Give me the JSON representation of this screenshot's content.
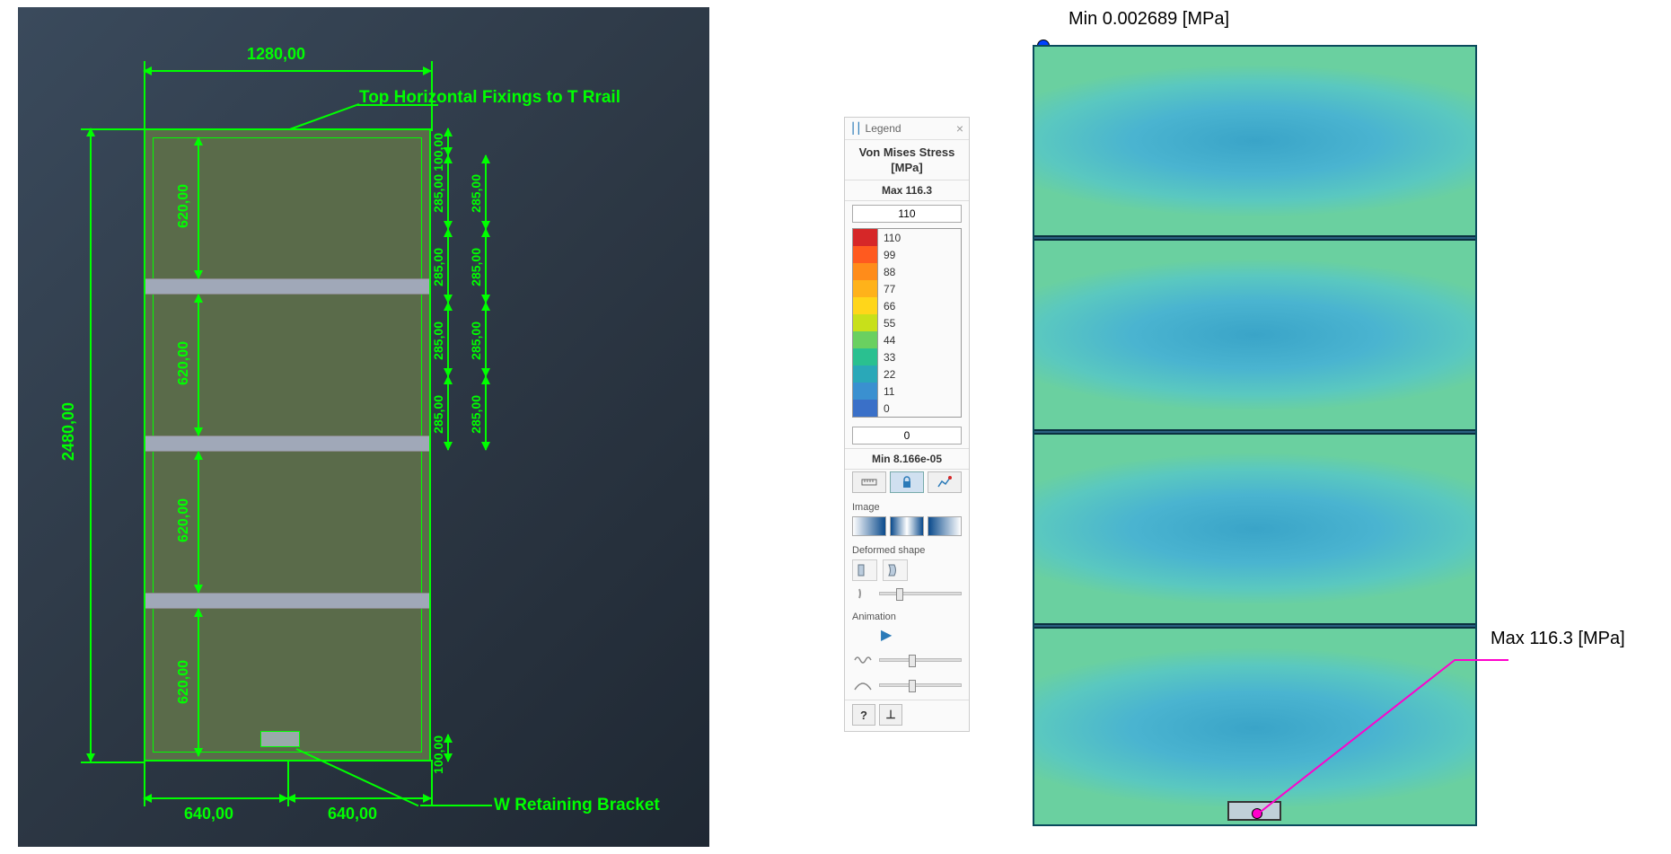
{
  "left": {
    "label_top": "Top Horizontal Fixings to T Rrail",
    "label_bottom": "W Retaining Bracket",
    "dim_width_top": "1280,00",
    "dim_height_left": "2480,00",
    "dim_width_bottom_left": "640,00",
    "dim_width_bottom_right": "640,00",
    "dim_100_top": "100,00",
    "dim_100_bot": "100,00",
    "dim_620": [
      "620,00",
      "620,00",
      "620,00",
      "620,00"
    ],
    "dim_285_outer": [
      "285,00",
      "285,00",
      "285,00",
      "285,00",
      "285,00",
      "285,00",
      "285,00",
      "285,00"
    ]
  },
  "right": {
    "min_label": "Min  0.002689  [MPa]",
    "max_label": "Max  116.3  [MPa]"
  },
  "legend": {
    "header": "Legend",
    "title": "Von Mises Stress",
    "unit": "[MPa]",
    "max_text": "Max  116.3",
    "min_text": "Min  8.166e-05",
    "input_top": "110",
    "input_bottom": "0",
    "scale": [
      {
        "v": "110",
        "c": "#d62728"
      },
      {
        "v": "99",
        "c": "#ff5a1f"
      },
      {
        "v": "88",
        "c": "#ff8c1a"
      },
      {
        "v": "77",
        "c": "#ffb21a"
      },
      {
        "v": "66",
        "c": "#ffd61a"
      },
      {
        "v": "55",
        "c": "#c8e01a"
      },
      {
        "v": "44",
        "c": "#6ad060"
      },
      {
        "v": "33",
        "c": "#2ac090"
      },
      {
        "v": "22",
        "c": "#2aa8b8"
      },
      {
        "v": "11",
        "c": "#3a90d0"
      },
      {
        "v": "0",
        "c": "#3a70c8"
      }
    ],
    "section_image": "Image",
    "section_deformed": "Deformed shape",
    "section_animation": "Animation",
    "help": "?",
    "pin": "⊥"
  }
}
